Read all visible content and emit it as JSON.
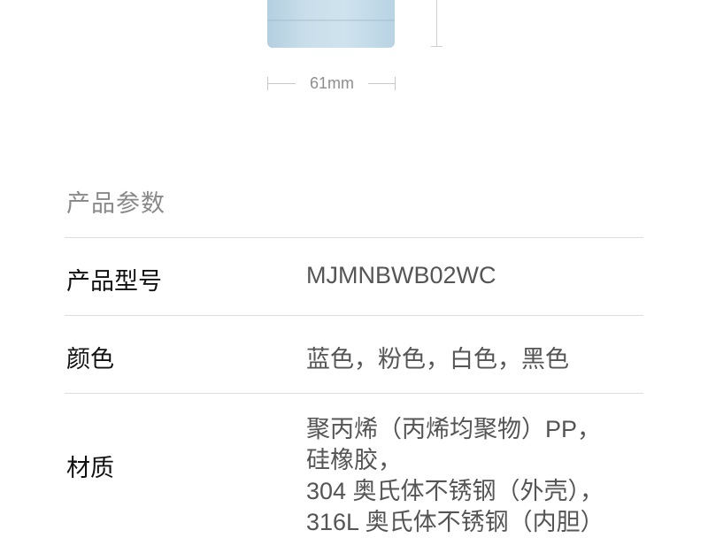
{
  "figure": {
    "width_label": "61mm",
    "bottle_color": "#c9deea"
  },
  "specs": {
    "section_title": "产品参数",
    "rows": [
      {
        "label": "产品型号",
        "value": "MJMNBWB02WC"
      },
      {
        "label": "颜色",
        "value": "蓝色，粉色，白色，黑色"
      },
      {
        "label": "材质",
        "lines": [
          "聚丙烯（丙烯均聚物）PP，",
          "硅橡胶，",
          "304 奥氏体不锈钢（外壳），",
          "316L 奥氏体不锈钢（内胆）"
        ]
      }
    ]
  }
}
